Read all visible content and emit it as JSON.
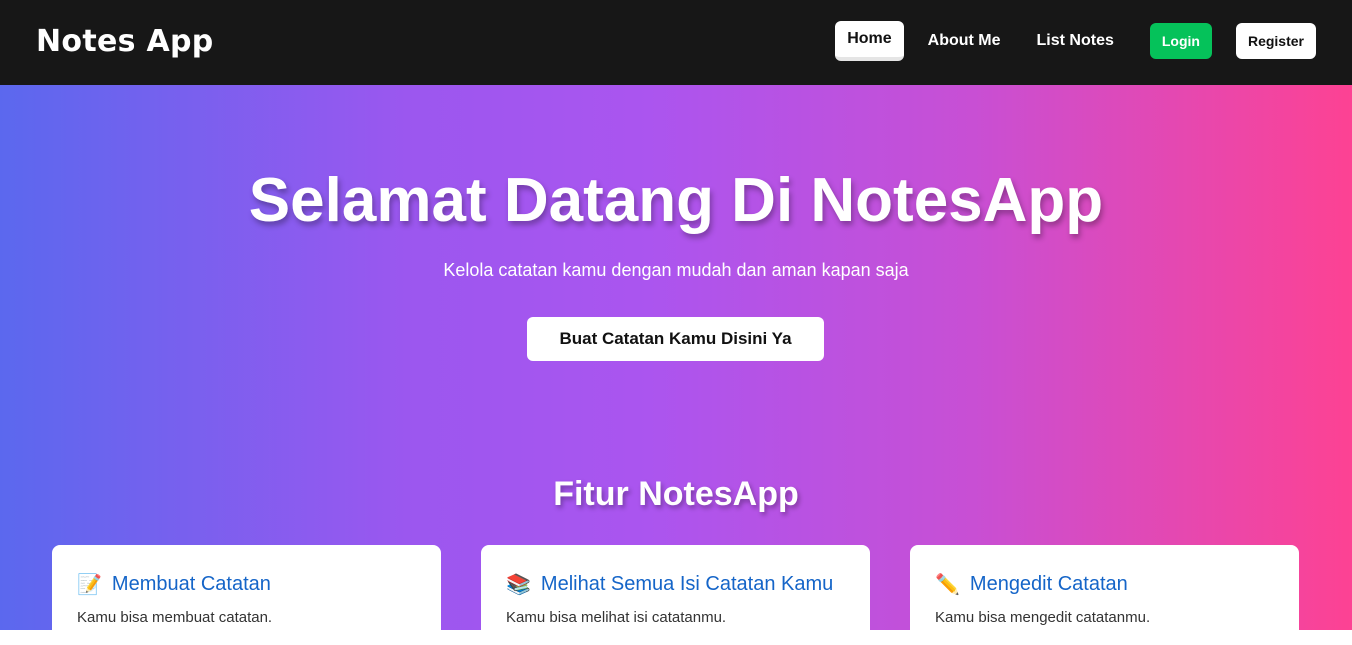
{
  "navbar": {
    "brand": "Notes App",
    "links": [
      {
        "label": "Home"
      },
      {
        "label": "About Me"
      },
      {
        "label": "List Notes"
      }
    ],
    "login_label": "Login",
    "register_label": "Register"
  },
  "hero": {
    "title": "Selamat Datang Di NotesApp",
    "subtitle": "Kelola catatan kamu dengan mudah dan aman kapan saja",
    "cta_label": "Buat Catatan Kamu Disini Ya"
  },
  "features": {
    "title": "Fitur NotesApp",
    "cards": [
      {
        "icon": "📝",
        "icon_name": "memo-icon",
        "title": "Membuat Catatan",
        "text": "Kamu bisa membuat catatan."
      },
      {
        "icon": "📚",
        "icon_name": "books-icon",
        "title": "Melihat Semua Isi Catatan Kamu",
        "text": "Kamu bisa melihat isi catatanmu."
      },
      {
        "icon": "✏️",
        "icon_name": "pencil-icon",
        "title": "Mengedit Catatan",
        "text": "Kamu bisa mengedit catatanmu."
      }
    ]
  },
  "colors": {
    "navbar_bg": "#171717",
    "login_green": "#05c25a",
    "card_title_blue": "#1565c8",
    "gradient_start": "#5b68ee",
    "gradient_end": "#fd4293"
  }
}
